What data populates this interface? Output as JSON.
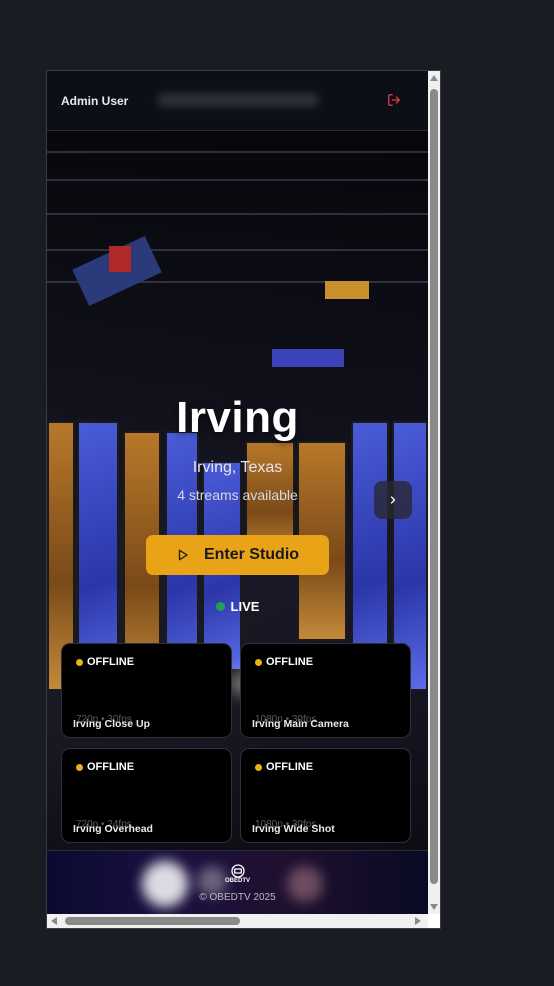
{
  "header": {
    "user_name": "Admin User",
    "logout_icon": "logout-icon"
  },
  "hero": {
    "title": "Irving",
    "location": "Irving, Texas",
    "streams": "4 streams available",
    "enter_label": "Enter Studio",
    "live_label": "LIVE",
    "accent": "#e8a317"
  },
  "streams": [
    {
      "status": "OFFLINE",
      "meta": "720p • 30fps",
      "name": "Irving Close Up"
    },
    {
      "status": "OFFLINE",
      "meta": "1080p • 30fps",
      "name": "Irving Main Camera"
    },
    {
      "status": "OFFLINE",
      "meta": "720p • 24fps",
      "name": "Irving Overhead"
    },
    {
      "status": "OFFLINE",
      "meta": "1080p • 30fps",
      "name": "Irving Wide Shot"
    }
  ],
  "footer": {
    "logo_text": "OBEDTV",
    "copyright": "© OBEDTV 2025"
  },
  "colors": {
    "offline": "#e8b317",
    "live": "#22a05a",
    "logout": "#e04040"
  }
}
